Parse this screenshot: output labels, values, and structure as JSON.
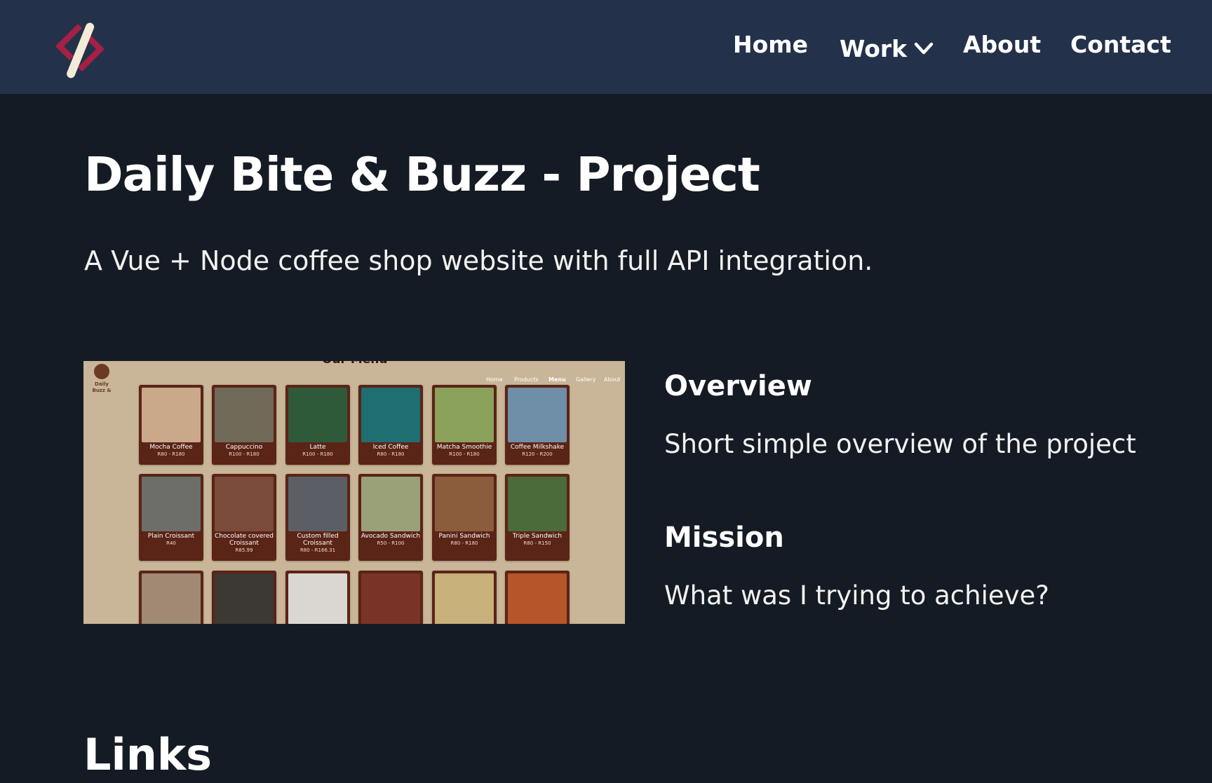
{
  "colors": {
    "background": "#151b24",
    "header": "#23324a",
    "logo_accent": "#a61f45",
    "logo_slash": "#f3ead8",
    "menu_bg": "#c9b597",
    "card_bg": "#5a2416"
  },
  "header": {
    "logo_icon": "slash-logo-icon",
    "nav": {
      "home": "Home",
      "work": "Work",
      "about": "About",
      "contact": "Contact"
    },
    "work_icon": "chevron-down-icon"
  },
  "page": {
    "title": "Daily Bite & Buzz - Project",
    "subtitle": "A Vue + Node coffee shop website with full API integration."
  },
  "screenshot": {
    "brand": "Daily Buzz &",
    "menu_title": "Our Menu",
    "nav": [
      "Home",
      "Products",
      "Menu",
      "Gallery",
      "About"
    ],
    "active_nav": "Menu",
    "items": [
      {
        "name": "Mocha Coffee",
        "price": "R80 - R180",
        "color": "#c9a98a"
      },
      {
        "name": "Cappuccino",
        "price": "R100 - R180",
        "color": "#6f6a57"
      },
      {
        "name": "Latte",
        "price": "R100 - R180",
        "color": "#2f5a3a"
      },
      {
        "name": "Iced Coffee",
        "price": "R80 - R180",
        "color": "#1e6e72"
      },
      {
        "name": "Matcha Smoothie",
        "price": "R100 - R180",
        "color": "#8aa25a"
      },
      {
        "name": "Coffee Milkshake",
        "price": "R120 - R200",
        "color": "#6f8fa8"
      },
      {
        "name": "Plain Croissant",
        "price": "R40",
        "color": "#6d6e6a"
      },
      {
        "name": "Chocolate covered Croissant",
        "price": "R85.99",
        "color": "#7a4a3a"
      },
      {
        "name": "Custom filled Croissant",
        "price": "R80 - R166.31",
        "color": "#5c5e66"
      },
      {
        "name": "Avocado Sandwich",
        "price": "R50 - R100",
        "color": "#9aa077"
      },
      {
        "name": "Panini Sandwich",
        "price": "R80 - R180",
        "color": "#8c5d3c"
      },
      {
        "name": "Triple Sandwich",
        "price": "R80 - R150",
        "color": "#4b6b3a"
      },
      {
        "name": "",
        "price": "",
        "color": "#a08a74"
      },
      {
        "name": "",
        "price": "",
        "color": "#3c3833"
      },
      {
        "name": "",
        "price": "",
        "color": "#dad7d2"
      },
      {
        "name": "",
        "price": "",
        "color": "#7a3327"
      },
      {
        "name": "",
        "price": "",
        "color": "#c7b07a"
      },
      {
        "name": "",
        "price": "",
        "color": "#b7552a"
      }
    ]
  },
  "sections": {
    "overview_heading": "Overview",
    "overview_text": "Short simple overview of the project",
    "mission_heading": "Mission",
    "mission_text": "What was I trying to achieve?",
    "links_heading": "Links"
  }
}
